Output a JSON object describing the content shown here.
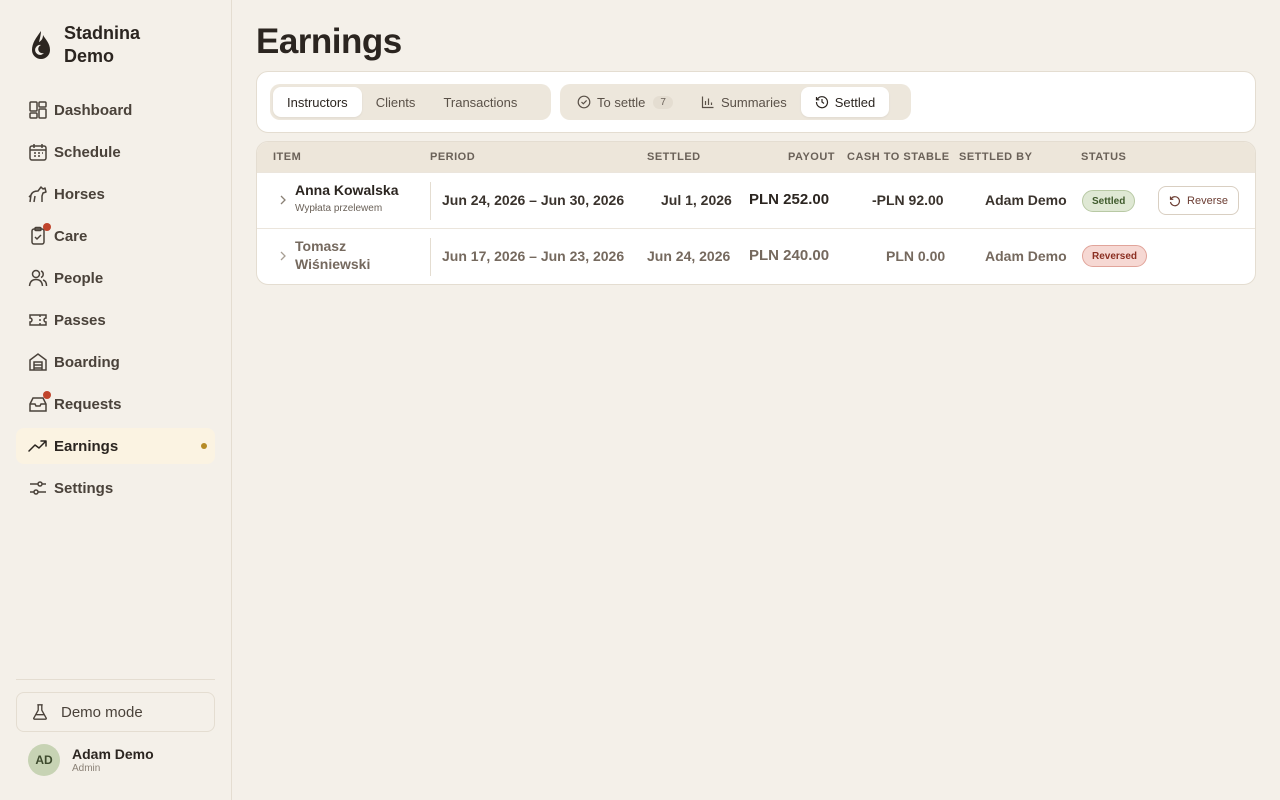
{
  "app": {
    "name": "Stadnina Demo"
  },
  "sidebar": {
    "items": [
      {
        "label": "Dashboard",
        "icon": "dashboard-icon"
      },
      {
        "label": "Schedule",
        "icon": "calendar-icon"
      },
      {
        "label": "Horses",
        "icon": "horse-icon"
      },
      {
        "label": "Care",
        "icon": "clipboard-icon",
        "badge": true
      },
      {
        "label": "People",
        "icon": "users-icon"
      },
      {
        "label": "Passes",
        "icon": "ticket-icon"
      },
      {
        "label": "Boarding",
        "icon": "stable-icon"
      },
      {
        "label": "Requests",
        "icon": "inbox-icon",
        "badge": true
      },
      {
        "label": "Earnings",
        "icon": "trending-up-icon",
        "active": true
      },
      {
        "label": "Settings",
        "icon": "sliders-icon"
      }
    ],
    "demo_mode": "Demo mode",
    "user": {
      "initials": "AD",
      "name": "Adam Demo",
      "role": "Admin"
    }
  },
  "page": {
    "title": "Earnings"
  },
  "tabs": {
    "group1": [
      "Instructors",
      "Clients",
      "Transactions"
    ],
    "group1_active": "Instructors",
    "to_settle": "To settle",
    "to_settle_count": "7",
    "summaries": "Summaries",
    "settled": "Settled",
    "group2_active": "Settled"
  },
  "table": {
    "headers": {
      "item": "ITEM",
      "period": "PERIOD",
      "settled": "SETTLED",
      "payout": "PAYOUT",
      "cash_to_stable": "CASH TO STABLE",
      "settled_by": "SETTLED BY",
      "status": "STATUS"
    },
    "rows": [
      {
        "name": "Anna Kowalska",
        "subtitle": "Wypłata przelewem",
        "period": "Jun 24, 2026 – Jun 30, 2026",
        "settled": "Jul 1, 2026",
        "payout": "PLN 252.00",
        "cash_to_stable": "-PLN 92.00",
        "settled_by": "Adam Demo",
        "status": "Settled",
        "action": "Reverse"
      },
      {
        "name_line1": "Tomasz",
        "name_line2": "Wiśniewski",
        "period": "Jun 17, 2026 – Jun 23, 2026",
        "settled": "Jun 24, 2026",
        "payout": "PLN 240.00",
        "cash_to_stable": "PLN 0.00",
        "settled_by": "Adam Demo",
        "status": "Reversed"
      }
    ]
  },
  "colors": {
    "background": "#f4f0e9",
    "active_nav": "#fbf3e2",
    "accent_dot": "#b58a26",
    "notification": "#c0442b",
    "settled_badge": "#dfe8d4",
    "reversed_badge": "#f6d8d3"
  }
}
